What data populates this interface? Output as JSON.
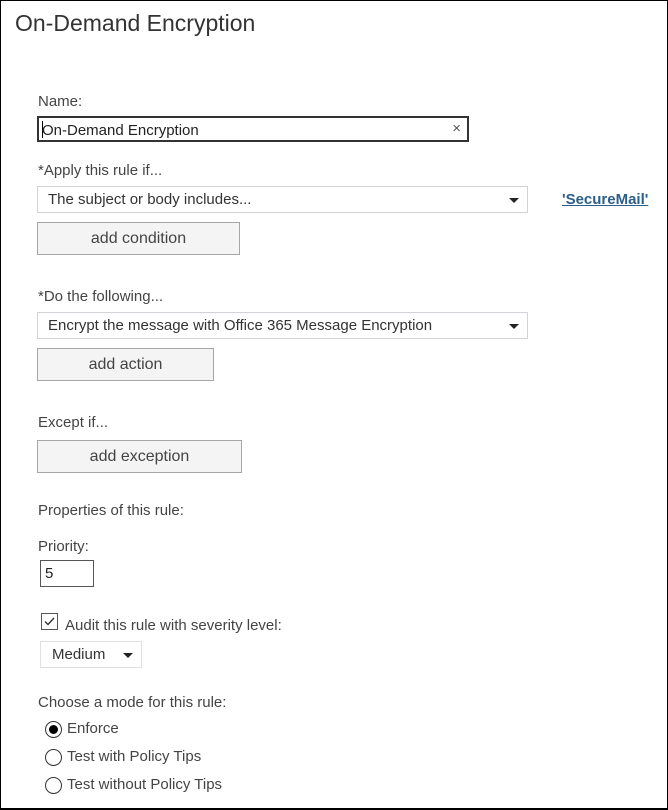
{
  "page": {
    "title": "On-Demand Encryption"
  },
  "name_field": {
    "label": "Name:",
    "value": "On-Demand Encryption",
    "clear_icon": "×"
  },
  "condition": {
    "label": "*Apply this rule if...",
    "selected": "The subject or body includes...",
    "keyword_link": "'SecureMail'",
    "add_button": "add condition"
  },
  "action": {
    "label": "*Do the following...",
    "selected": "Encrypt the message with Office 365 Message Encryption",
    "add_button": "add action"
  },
  "exception": {
    "label": "Except if...",
    "add_button": "add exception"
  },
  "properties": {
    "heading": "Properties of this rule:",
    "priority_label": "Priority:",
    "priority_value": "5",
    "audit": {
      "label": "Audit this rule with severity level:",
      "checked": true
    },
    "severity": {
      "selected": "Medium"
    }
  },
  "mode": {
    "label": "Choose a mode for this rule:",
    "options": [
      {
        "label": "Enforce",
        "selected": true
      },
      {
        "label": "Test with Policy Tips",
        "selected": false
      },
      {
        "label": "Test without Policy Tips",
        "selected": false
      }
    ]
  }
}
